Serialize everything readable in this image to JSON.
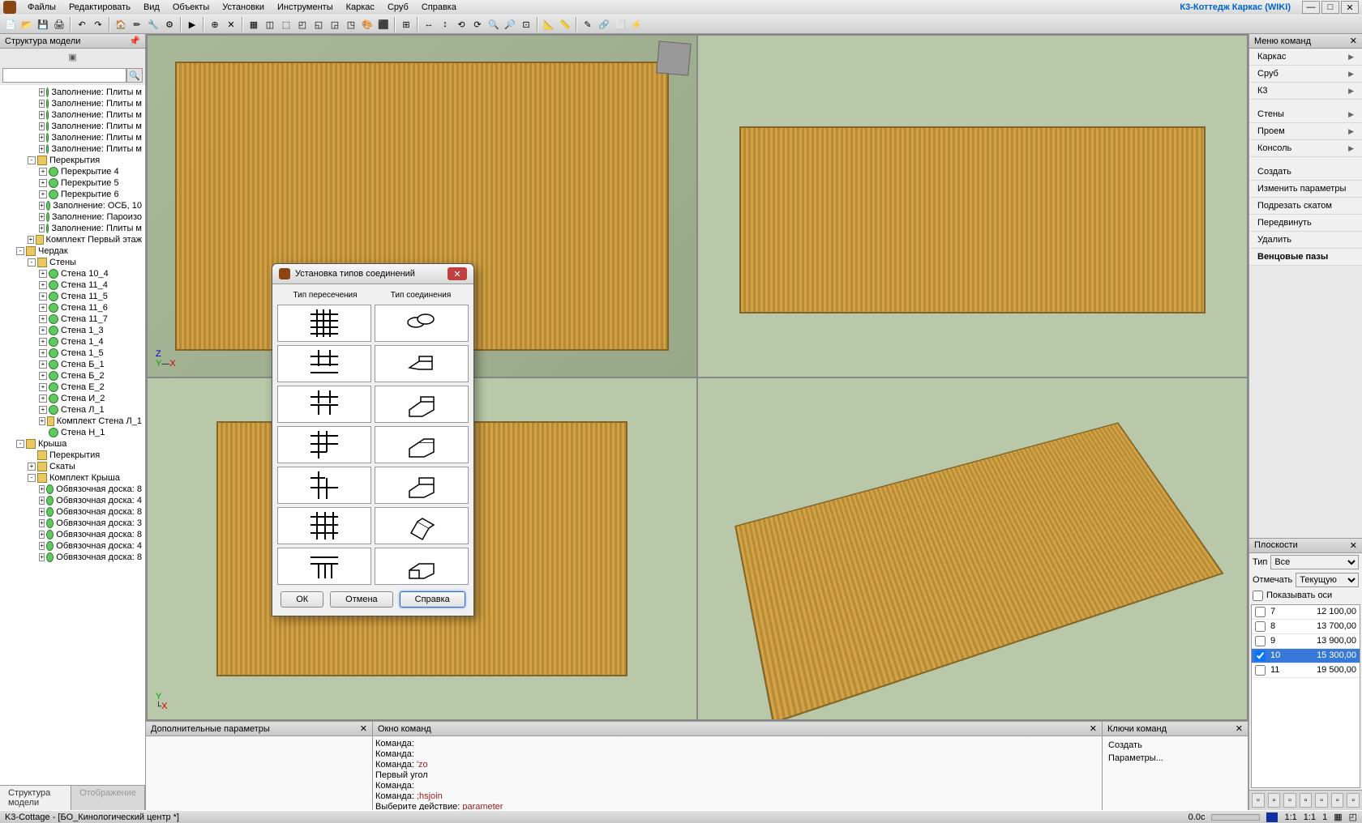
{
  "titlebar": {
    "menus": [
      "Файлы",
      "Редактировать",
      "Вид",
      "Объекты",
      "Установки",
      "Инструменты",
      "Каркас",
      "Сруб",
      "Справка"
    ],
    "app_title": "К3-Коттедж Каркас (WIKI)"
  },
  "left_panel": {
    "title": "Структура модели",
    "tabs": [
      "Структура модели",
      "Отображение"
    ],
    "tree": [
      {
        "ind": 3,
        "exp": "+",
        "ico": "green",
        "label": "Заполнение: Плиты м"
      },
      {
        "ind": 3,
        "exp": "+",
        "ico": "green",
        "label": "Заполнение: Плиты м"
      },
      {
        "ind": 3,
        "exp": "+",
        "ico": "green",
        "label": "Заполнение: Плиты м"
      },
      {
        "ind": 3,
        "exp": "+",
        "ico": "green",
        "label": "Заполнение: Плиты м"
      },
      {
        "ind": 3,
        "exp": "+",
        "ico": "green",
        "label": "Заполнение: Плиты м"
      },
      {
        "ind": 3,
        "exp": "+",
        "ico": "green",
        "label": "Заполнение: Плиты м"
      },
      {
        "ind": 2,
        "exp": "-",
        "ico": "folder",
        "label": "Перекрытия"
      },
      {
        "ind": 3,
        "exp": "+",
        "ico": "green",
        "label": "Перекрытие 4"
      },
      {
        "ind": 3,
        "exp": "+",
        "ico": "green",
        "label": "Перекрытие 5"
      },
      {
        "ind": 3,
        "exp": "+",
        "ico": "green",
        "label": "Перекрытие 6"
      },
      {
        "ind": 3,
        "exp": "+",
        "ico": "green",
        "label": "Заполнение: ОСБ, 10"
      },
      {
        "ind": 3,
        "exp": "+",
        "ico": "green",
        "label": "Заполнение: Пароизо"
      },
      {
        "ind": 3,
        "exp": "+",
        "ico": "green",
        "label": "Заполнение: Плиты м"
      },
      {
        "ind": 2,
        "exp": "+",
        "ico": "folder",
        "label": "Комплект Первый этаж"
      },
      {
        "ind": 1,
        "exp": "-",
        "ico": "folder",
        "label": "Чердак"
      },
      {
        "ind": 2,
        "exp": "-",
        "ico": "folder",
        "label": "Стены"
      },
      {
        "ind": 3,
        "exp": "+",
        "ico": "green",
        "label": "Стена 10_4"
      },
      {
        "ind": 3,
        "exp": "+",
        "ico": "green",
        "label": "Стена 11_4"
      },
      {
        "ind": 3,
        "exp": "+",
        "ico": "green",
        "label": "Стена 11_5"
      },
      {
        "ind": 3,
        "exp": "+",
        "ico": "green",
        "label": "Стена 11_6"
      },
      {
        "ind": 3,
        "exp": "+",
        "ico": "green",
        "label": "Стена 11_7"
      },
      {
        "ind": 3,
        "exp": "+",
        "ico": "green",
        "label": "Стена 1_3"
      },
      {
        "ind": 3,
        "exp": "+",
        "ico": "green",
        "label": "Стена 1_4"
      },
      {
        "ind": 3,
        "exp": "+",
        "ico": "green",
        "label": "Стена 1_5"
      },
      {
        "ind": 3,
        "exp": "+",
        "ico": "green",
        "label": "Стена Б_1"
      },
      {
        "ind": 3,
        "exp": "+",
        "ico": "green",
        "label": "Стена Б_2"
      },
      {
        "ind": 3,
        "exp": "+",
        "ico": "green",
        "label": "Стена Е_2"
      },
      {
        "ind": 3,
        "exp": "+",
        "ico": "green",
        "label": "Стена И_2"
      },
      {
        "ind": 3,
        "exp": "+",
        "ico": "green",
        "label": "Стена Л_1"
      },
      {
        "ind": 3,
        "exp": "+",
        "ico": "folder",
        "label": "Комплект Стена Л_1"
      },
      {
        "ind": 3,
        "exp": "",
        "ico": "green",
        "label": "Стена Н_1"
      },
      {
        "ind": 1,
        "exp": "-",
        "ico": "folder",
        "label": "Крыша"
      },
      {
        "ind": 2,
        "exp": "",
        "ico": "folder",
        "label": "Перекрытия"
      },
      {
        "ind": 2,
        "exp": "+",
        "ico": "folder",
        "label": "Скаты"
      },
      {
        "ind": 2,
        "exp": "-",
        "ico": "folder",
        "label": "Комплект Крыша"
      },
      {
        "ind": 3,
        "exp": "+",
        "ico": "green",
        "label": "Обвязочная доска: 8"
      },
      {
        "ind": 3,
        "exp": "+",
        "ico": "green",
        "label": "Обвязочная доска: 4"
      },
      {
        "ind": 3,
        "exp": "+",
        "ico": "green",
        "label": "Обвязочная доска: 8"
      },
      {
        "ind": 3,
        "exp": "+",
        "ico": "green",
        "label": "Обвязочная доска: 3"
      },
      {
        "ind": 3,
        "exp": "+",
        "ico": "green",
        "label": "Обвязочная доска: 8"
      },
      {
        "ind": 3,
        "exp": "+",
        "ico": "green",
        "label": "Обвязочная доска: 4"
      },
      {
        "ind": 3,
        "exp": "+",
        "ico": "green",
        "label": "Обвязочная доска: 8"
      }
    ]
  },
  "right_panel": {
    "title": "Меню команд",
    "groups": [
      {
        "items": [
          {
            "l": "Каркас",
            "arr": true
          },
          {
            "l": "Сруб",
            "arr": true
          },
          {
            "l": "К3",
            "arr": true
          }
        ]
      },
      {
        "items": [
          {
            "l": "Стены",
            "arr": true
          },
          {
            "l": "Проем",
            "arr": true
          },
          {
            "l": "Консоль",
            "arr": true
          }
        ]
      },
      {
        "items": [
          {
            "l": "Создать"
          },
          {
            "l": "Изменить параметры"
          },
          {
            "l": "Подрезать скатом"
          },
          {
            "l": "Передвинуть"
          },
          {
            "l": "Удалить"
          },
          {
            "l": "Венцовые пазы",
            "bold": true
          }
        ]
      }
    ]
  },
  "planes": {
    "title": "Плоскости",
    "type_label": "Тип",
    "type_value": "Все",
    "mark_label": "Отмечать",
    "mark_value": "Текущую",
    "show_axes": "Показывать оси",
    "items": [
      {
        "chk": false,
        "n": "7",
        "v": "12 100,00"
      },
      {
        "chk": false,
        "n": "8",
        "v": "13 700,00"
      },
      {
        "chk": false,
        "n": "9",
        "v": "13 900,00"
      },
      {
        "chk": true,
        "n": "10",
        "v": "15 300,00",
        "selected": true
      },
      {
        "chk": false,
        "n": "11",
        "v": "19 500,00"
      }
    ]
  },
  "bottom": {
    "p1_title": "Дополнительные параметры",
    "p2_title": "Окно команд",
    "p3_title": "Ключи команд",
    "commands": [
      {
        "pre": "Команда:",
        "val": ""
      },
      {
        "pre": "Команда:",
        "val": ""
      },
      {
        "pre": "Команда: ",
        "val": "'zo",
        "red": true
      },
      {
        "pre": "Первый угол",
        "val": ""
      },
      {
        "pre": "Команда:",
        "val": ""
      },
      {
        "pre": "Команда: ",
        "val": ";hsjoin",
        "red": true
      },
      {
        "pre": "Выберите действие: ",
        "val": "parameter",
        "red": true
      }
    ],
    "keys": [
      "Создать",
      "Параметры..."
    ]
  },
  "statusbar": {
    "file": "K3-Cottage - [БО_Кинологический центр *]",
    "time": "0.0c",
    "ratios": [
      "1:1",
      "1:1",
      "1"
    ]
  },
  "dialog": {
    "title": "Установка типов соединений",
    "col1": "Тип пересечения",
    "col2": "Тип соединения",
    "ok": "ОК",
    "cancel": "Отмена",
    "help": "Справка"
  }
}
